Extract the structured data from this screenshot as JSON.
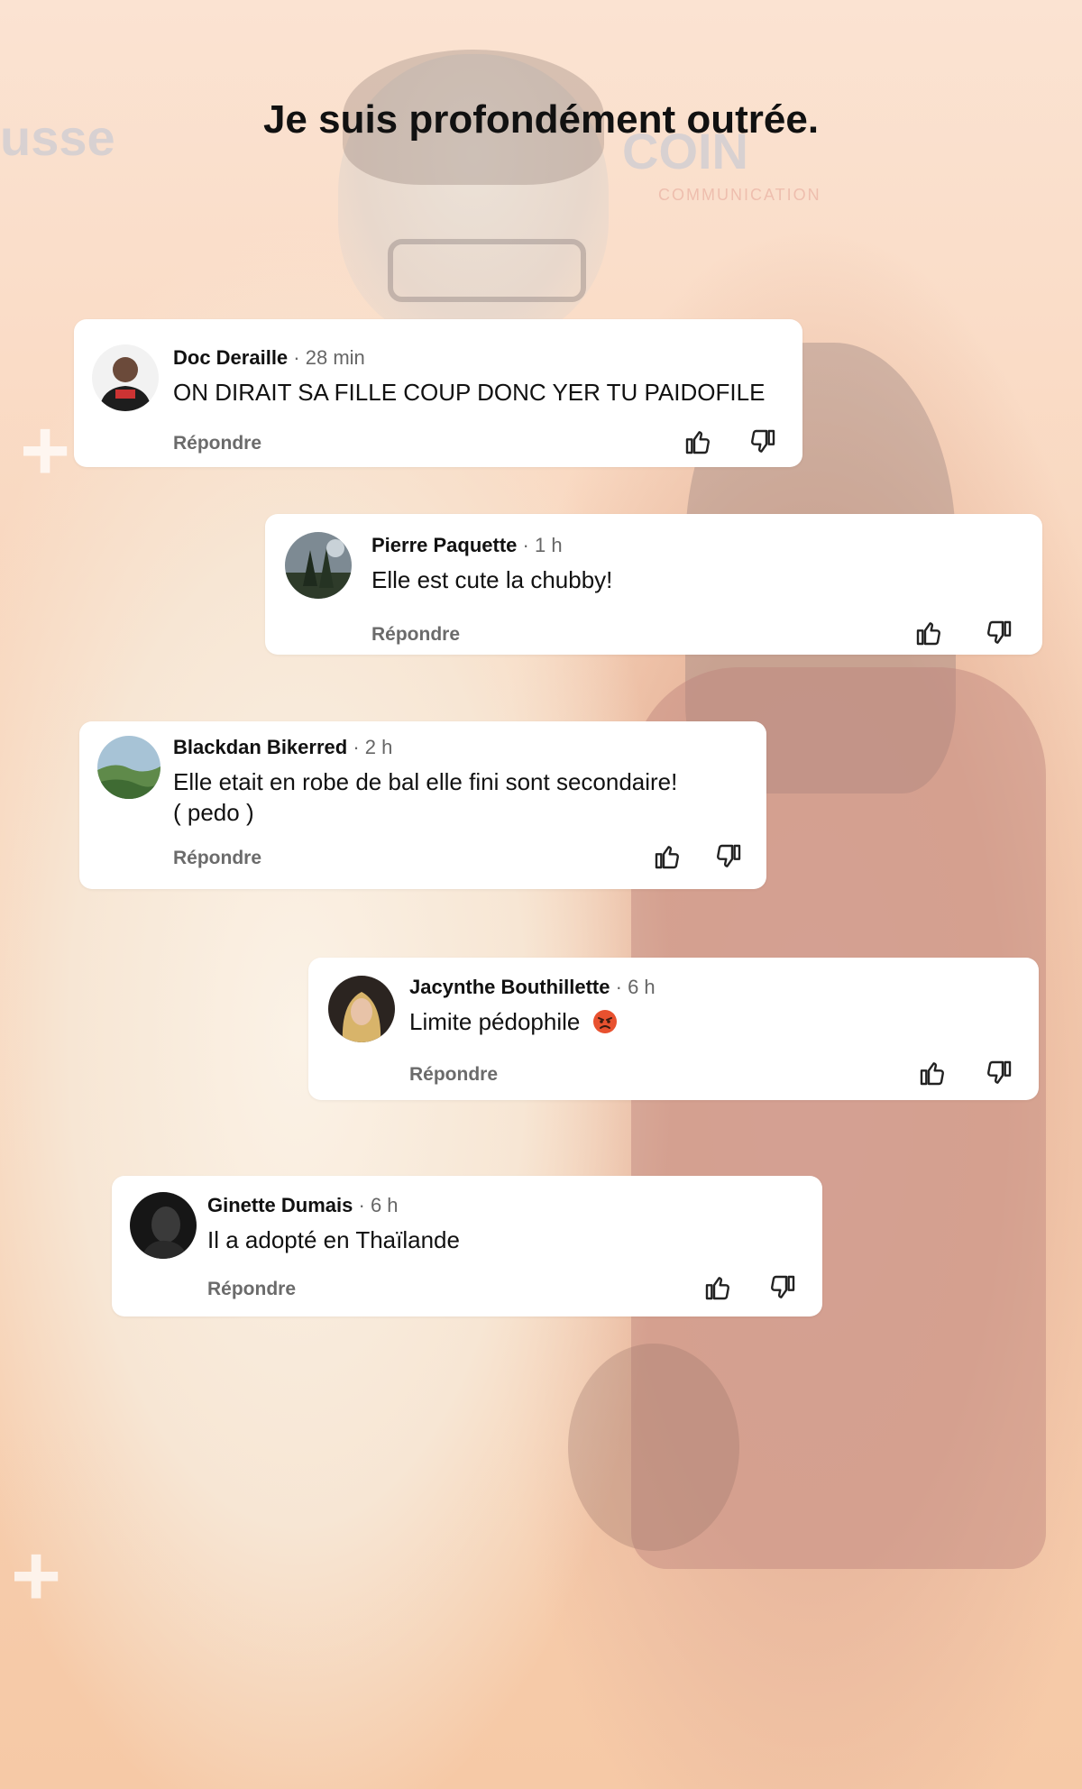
{
  "headline": "Je suis profondément outrée.",
  "background": {
    "logo_left": "usse",
    "logo_right": "COIN",
    "logo_sub": "COMMUNICATION"
  },
  "comments": [
    {
      "author": "Doc Deraille",
      "separator": "·",
      "time": "28 min",
      "text": "ON DIRAIT SA FILLE COUP DONC YER TU PAIDOFILE",
      "reply": "Répondre"
    },
    {
      "author": "Pierre Paquette",
      "separator": "·",
      "time": "1 h",
      "text": "Elle est cute la chubby!",
      "reply": "Répondre"
    },
    {
      "author": "Blackdan Bikerred",
      "separator": "·",
      "time": "2 h",
      "text_line1": "Elle etait en robe de bal elle fini sont secondaire!",
      "text_line2": "( pedo )",
      "reply": "Répondre"
    },
    {
      "author": "Jacynthe Bouthillette",
      "separator": "·",
      "time": "6 h",
      "text": "Limite pédophile",
      "emoji": "angry-face-emoji",
      "reply": "Répondre"
    },
    {
      "author": "Ginette Dumais",
      "separator": "·",
      "time": "6 h",
      "text": "Il a adopté en Thaïlande",
      "reply": "Répondre"
    }
  ],
  "icons": {
    "like": "thumbs-up-icon",
    "dislike": "thumbs-down-icon"
  },
  "colors": {
    "card": "#ffffff",
    "text": "#111111",
    "meta": "#666666",
    "reply": "#6b6b6b"
  }
}
